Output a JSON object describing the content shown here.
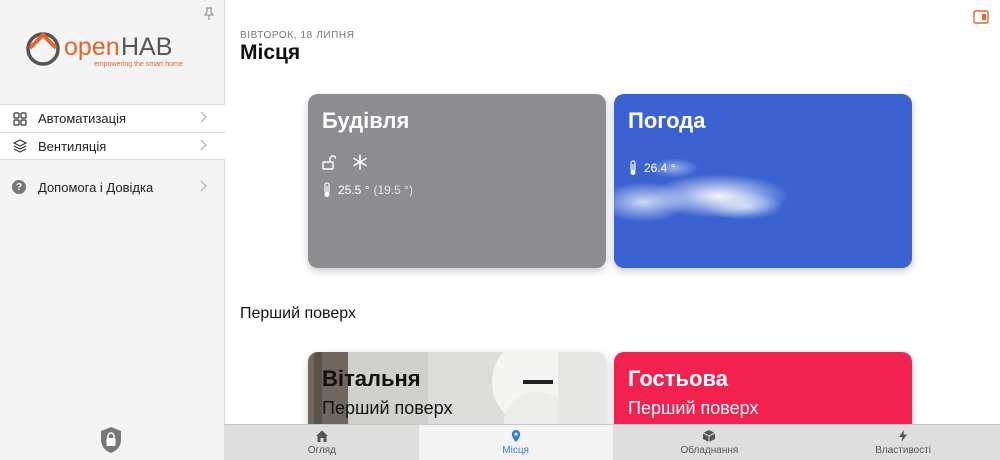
{
  "brand": {
    "name_part1": "open",
    "name_part2": "HAB",
    "tagline": "empowering the smart home",
    "accent_color": "#e8622a"
  },
  "sidebar": {
    "items": [
      {
        "label": "Автоматизація",
        "icon": "grid-icon"
      },
      {
        "label": "Вентиляція",
        "icon": "layers-icon"
      }
    ],
    "help": {
      "label": "Допомога і Довідка",
      "icon": "question-icon"
    }
  },
  "header": {
    "date": "Вівторок, 18 липня",
    "title": "Місця"
  },
  "cards": {
    "building": {
      "title": "Будівля",
      "temp": "25.5 °",
      "temp_secondary": "(19.5 °)",
      "color": "#8d8d91"
    },
    "weather": {
      "title": "Погода",
      "temp": "26.4 °",
      "color": "#3a63d1"
    },
    "living": {
      "title": "Вітальня",
      "subtitle": "Перший поверх"
    },
    "guest": {
      "title": "Гостьова",
      "subtitle": "Перший поверх",
      "color": "#f3214e"
    }
  },
  "section": {
    "first_floor": "Перший поверх"
  },
  "tabs": [
    {
      "label": "Огляд",
      "icon": "home-icon",
      "active": false
    },
    {
      "label": "Місця",
      "icon": "location-pin-icon",
      "active": true
    },
    {
      "label": "Обладнання",
      "icon": "cube-icon",
      "active": false
    },
    {
      "label": "Властивості",
      "icon": "lightning-icon",
      "active": false
    }
  ]
}
